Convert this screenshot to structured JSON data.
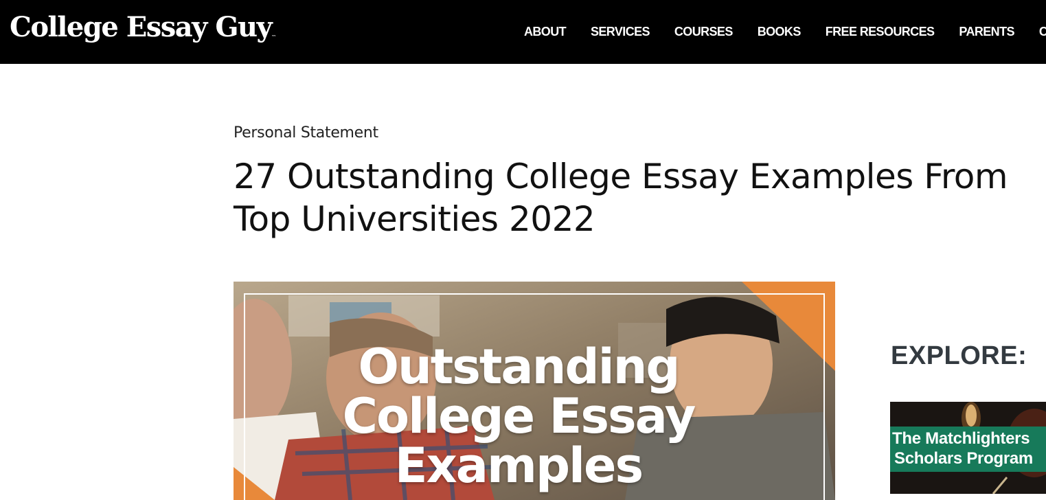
{
  "header": {
    "logo_text": "College Essay Guy",
    "logo_tm": "™",
    "nav": [
      {
        "label": "ABOUT"
      },
      {
        "label": "SERVICES"
      },
      {
        "label": "COURSES"
      },
      {
        "label": "BOOKS"
      },
      {
        "label": "FREE RESOURCES"
      },
      {
        "label": "PARENTS"
      },
      {
        "label": "C"
      }
    ]
  },
  "article": {
    "category": "Personal Statement",
    "title": "27 Outstanding College Essay Examples From Top Universities 2022",
    "hero": {
      "lines": [
        "Outstanding",
        "College Essay",
        "Examples"
      ]
    }
  },
  "sidebar": {
    "explore_heading": "EXPLORE:",
    "promo": {
      "lines": [
        "The Matchlighters",
        "Scholars Program"
      ]
    }
  },
  "colors": {
    "header_bg": "#000000",
    "accent_orange": "#e8893a",
    "promo_green": "#177a5a",
    "heading_gray": "#333a40"
  }
}
